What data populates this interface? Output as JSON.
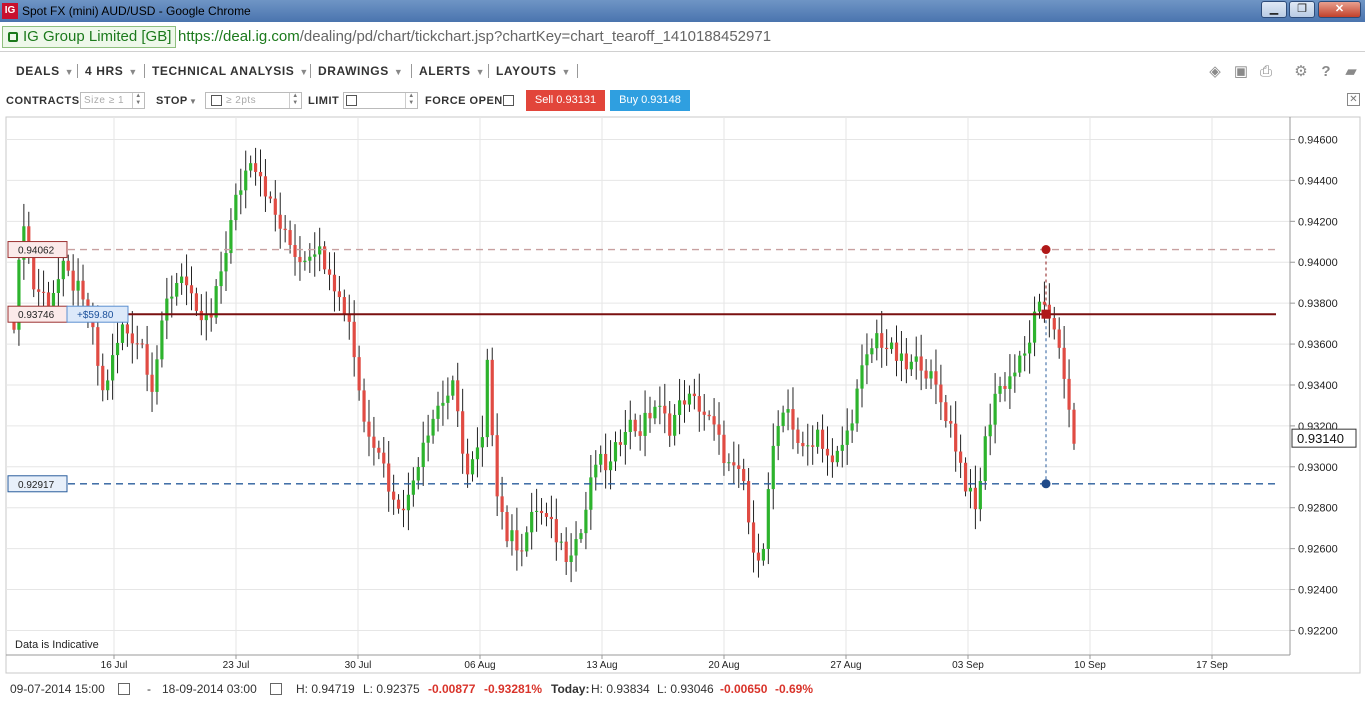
{
  "window": {
    "title": "Spot FX (mini) AUD/USD - Google Chrome",
    "logo": "IG",
    "buttons": [
      "minimize",
      "maximize",
      "close"
    ]
  },
  "address_bar": {
    "site_identity": "IG Group Limited [GB]",
    "url_scheme_host": "https://deal.ig.com",
    "url_path": "/dealing/pd/chart/tickchart.jsp?chartKey=chart_tearoff_1410188452971"
  },
  "menu": {
    "items": [
      {
        "label": "DEALS"
      },
      {
        "label": "4 HRS"
      },
      {
        "label": "TECHNICAL ANALYSIS"
      },
      {
        "label": "DRAWINGS"
      },
      {
        "label": "ALERTS"
      },
      {
        "label": "LAYOUTS"
      }
    ],
    "tool_icons": [
      "layers-icon",
      "image-icon",
      "print-icon",
      "gear-icon",
      "help-icon",
      "comment-icon"
    ]
  },
  "deal_ticket": {
    "contracts_label": "CONTRACTS",
    "contracts_placeholder": "Size ≥ 1",
    "stop_label": "STOP",
    "stop_placeholder": "≥ 2pts",
    "limit_label": "LIMIT",
    "force_open_label": "FORCE OPEN",
    "sell_label": "Sell 0.93131",
    "buy_label": "Buy 0.93148"
  },
  "chart_data": {
    "type": "candlestick",
    "instrument": "Spot FX (mini) AUD/USD",
    "interval": "4 HRS",
    "y_ticks": [
      0.922,
      0.924,
      0.926,
      0.928,
      0.93,
      0.932,
      0.934,
      0.936,
      0.938,
      0.94,
      0.942,
      0.944,
      0.946
    ],
    "y_tick_labels": [
      "0.92200",
      "0.92400",
      "0.92600",
      "0.92800",
      "0.93000",
      "0.93200",
      "0.93400",
      "0.93600",
      "0.93800",
      "0.94000",
      "0.94200",
      "0.94400",
      "0.94600"
    ],
    "ylim": [
      0.9208,
      0.9471
    ],
    "x_ticks": [
      "16 Jul",
      "23 Jul",
      "30 Jul",
      "06 Aug",
      "13 Aug",
      "20 Aug",
      "27 Aug",
      "03 Sep",
      "10 Sep",
      "17 Sep"
    ],
    "current_price_label": "0.93140",
    "current_price": 0.9314,
    "watermark": "Data is Indicative",
    "levels": [
      {
        "label": "0.94062",
        "value": 0.94062,
        "style": "dashed",
        "color": "#c8a0a0"
      },
      {
        "label": "0.93746",
        "value": 0.93746,
        "style": "solid",
        "color": "#7a1010",
        "pnl": "+$59.80"
      },
      {
        "label": "0.92917",
        "value": 0.92917,
        "style": "dashed",
        "color": "#2a5d9c"
      }
    ],
    "waypoints": [
      [
        0,
        0.9372
      ],
      [
        2,
        0.9422
      ],
      [
        4,
        0.9388
      ],
      [
        7,
        0.9382
      ],
      [
        10,
        0.9396
      ],
      [
        13,
        0.9386
      ],
      [
        16,
        0.9364
      ],
      [
        18,
        0.9336
      ],
      [
        22,
        0.9368
      ],
      [
        26,
        0.936
      ],
      [
        28,
        0.934
      ],
      [
        31,
        0.938
      ],
      [
        34,
        0.9396
      ],
      [
        37,
        0.9372
      ],
      [
        40,
        0.9372
      ],
      [
        42,
        0.9396
      ],
      [
        45,
        0.943
      ],
      [
        48,
        0.9452
      ],
      [
        50,
        0.9444
      ],
      [
        52,
        0.9428
      ],
      [
        55,
        0.9412
      ],
      [
        58,
        0.9402
      ],
      [
        61,
        0.9408
      ],
      [
        64,
        0.9398
      ],
      [
        66,
        0.9382
      ],
      [
        68,
        0.9372
      ],
      [
        71,
        0.9322
      ],
      [
        74,
        0.931
      ],
      [
        77,
        0.9282
      ],
      [
        80,
        0.9284
      ],
      [
        83,
        0.9314
      ],
      [
        86,
        0.933
      ],
      [
        89,
        0.9338
      ],
      [
        92,
        0.9296
      ],
      [
        95,
        0.9312
      ],
      [
        96,
        0.9348
      ],
      [
        98,
        0.929
      ],
      [
        100,
        0.9266
      ],
      [
        103,
        0.9262
      ],
      [
        106,
        0.928
      ],
      [
        109,
        0.927
      ],
      [
        112,
        0.9258
      ],
      [
        115,
        0.9268
      ],
      [
        118,
        0.9302
      ],
      [
        121,
        0.93
      ],
      [
        124,
        0.9322
      ],
      [
        127,
        0.9318
      ],
      [
        130,
        0.933
      ],
      [
        133,
        0.932
      ],
      [
        136,
        0.9334
      ],
      [
        139,
        0.933
      ],
      [
        142,
        0.9318
      ],
      [
        145,
        0.93
      ],
      [
        148,
        0.9292
      ],
      [
        150,
        0.9254
      ],
      [
        152,
        0.9264
      ],
      [
        154,
        0.931
      ],
      [
        157,
        0.9328
      ],
      [
        160,
        0.9306
      ],
      [
        163,
        0.9318
      ],
      [
        166,
        0.93
      ],
      [
        169,
        0.9316
      ],
      [
        172,
        0.9346
      ],
      [
        175,
        0.9364
      ],
      [
        178,
        0.9356
      ],
      [
        181,
        0.9348
      ],
      [
        184,
        0.9352
      ],
      [
        187,
        0.9338
      ],
      [
        190,
        0.932
      ],
      [
        193,
        0.9292
      ],
      [
        195,
        0.9278
      ],
      [
        197,
        0.9312
      ],
      [
        199,
        0.9336
      ],
      [
        202,
        0.9344
      ],
      [
        205,
        0.9354
      ],
      [
        207,
        0.9372
      ],
      [
        209,
        0.938
      ],
      [
        211,
        0.937
      ],
      [
        213,
        0.934
      ],
      [
        215,
        0.9314
      ]
    ]
  },
  "footer": {
    "from": "09-07-2014 15:00",
    "dash": "-",
    "to": "18-09-2014 03:00",
    "high": "H: 0.94719",
    "low": "L: 0.92375",
    "change": "-0.00877",
    "change_pct": "-0.93281%",
    "today_label": "Today:",
    "today_high": "H: 0.93834",
    "today_low": "L: 0.93046",
    "today_change": "-0.00650",
    "today_change_pct": "-0.69%"
  }
}
